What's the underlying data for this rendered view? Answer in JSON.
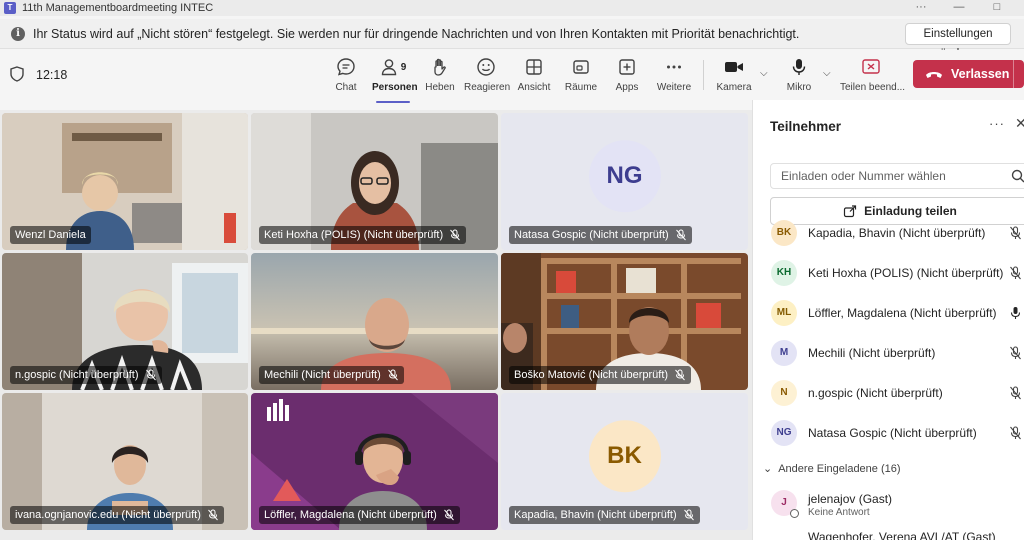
{
  "window": {
    "title": "11th Managementboardmeeting INTEC",
    "more": "···",
    "minimize": "—",
    "maximize": "□"
  },
  "notice": {
    "text": "Ihr Status wird auf „Nicht stören“ festgelegt. Sie werden nur für dringende Nachrichten und von Ihren Kontakten mit Priorität benachrichtigt.",
    "settings_label": "Einstellungen ändern"
  },
  "toolbar": {
    "time": "12:18",
    "chat": "Chat",
    "people": "Personen",
    "people_count": "9",
    "raise": "Heben",
    "react": "Reagieren",
    "view": "Ansicht",
    "rooms": "Räume",
    "apps": "Apps",
    "more": "Weitere",
    "camera": "Kamera",
    "mic": "Mikro",
    "share": "Teilen beend...",
    "leave": "Verlassen"
  },
  "tiles": [
    {
      "name": "Wenzl Daniela",
      "muted": false
    },
    {
      "name": "Keti Hoxha (POLIS) (Nicht überprüft)",
      "muted": true
    },
    {
      "name": "Natasa Gospic (Nicht überprüft)",
      "muted": true,
      "initials": "NG"
    },
    {
      "name": "n.gospic (Nicht überprüft)",
      "muted": true
    },
    {
      "name": "Mechili (Nicht überprüft)",
      "muted": true
    },
    {
      "name": "Boško Matović (Nicht überprüft)",
      "muted": true
    },
    {
      "name": "ivana.ognjanovic.edu (Nicht überprüft)",
      "muted": true
    },
    {
      "name": "Löffler, Magdalena (Nicht überprüft)",
      "muted": true
    },
    {
      "name": "Kapadia, Bhavin (Nicht überprüft)",
      "muted": true,
      "initials": "BK"
    }
  ],
  "panel": {
    "title": "Teilnehmer",
    "more": "···",
    "close": "✕",
    "invite_placeholder": "Einladen oder Nummer wählen",
    "share_invite": "Einladung teilen",
    "participants": [
      {
        "initials": "BK",
        "name": "Kapadia, Bhavin (Nicht überprüft)",
        "muted": true,
        "bg": "#fbe7c6",
        "fg": "#8a5a00"
      },
      {
        "initials": "KH",
        "name": "Keti Hoxha (POLIS) (Nicht überprüft)",
        "muted": true,
        "bg": "#dff3e6",
        "fg": "#0b6a2f"
      },
      {
        "initials": "ML",
        "name": "Löffler, Magdalena (Nicht überprüft)",
        "muted": false,
        "bg": "#fdf0c4",
        "fg": "#835b00"
      },
      {
        "initials": "M",
        "name": "Mechili (Nicht überprüft)",
        "muted": true,
        "bg": "#e3e3f5",
        "fg": "#3d3d8f"
      },
      {
        "initials": "N",
        "name": "n.gospic (Nicht überprüft)",
        "muted": true,
        "bg": "#fdf1d4",
        "fg": "#8a5a00"
      },
      {
        "initials": "NG",
        "name": "Natasa Gospic (Nicht überprüft)",
        "muted": true,
        "bg": "#e3e3f5",
        "fg": "#3d3d8f"
      }
    ],
    "others_header": "Andere Eingeladene (16)",
    "guest_initial": "J",
    "guest_name": "jelenajov (Gast)",
    "guest_status": "Keine Antwort",
    "guest2_name": "Wagenhofer, Verena AVL/AT (Gast)"
  },
  "colors": {
    "accent": "#5b5fc7",
    "leave": "#c4314b",
    "tile_overlay": "#000000"
  }
}
